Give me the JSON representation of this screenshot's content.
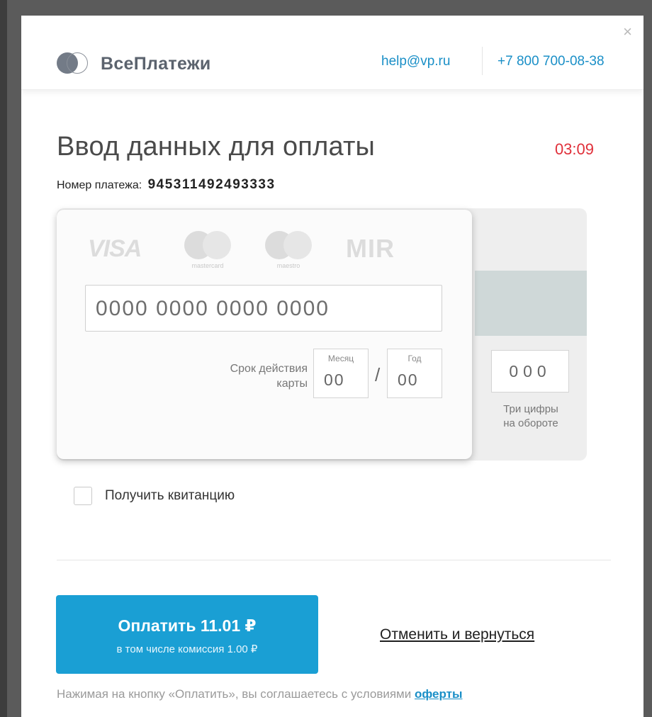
{
  "header": {
    "logo_text": "ВсеПлатежи",
    "email": "help@vp.ru",
    "phone": "+7 800 700-08-38",
    "close": "×"
  },
  "form": {
    "title": "Ввод данных для оплаты",
    "timer": "03:09",
    "payment_number_label": "Номер платежа:",
    "payment_number": "945311492493333"
  },
  "card": {
    "brands": {
      "visa": "VISA",
      "mastercard": "mastercard",
      "maestro": "maestro",
      "mir": "MIR"
    },
    "number_placeholder": "0000 0000 0000 0000",
    "expiry_label_line1": "Срок действия",
    "expiry_label_line2": "карты",
    "month_label": "Месяц",
    "month_placeholder": "00",
    "year_label": "Год",
    "year_placeholder": "00",
    "separator": "/",
    "cvv_placeholder": "000",
    "cvv_hint_line1": "Три цифры",
    "cvv_hint_line2": "на обороте"
  },
  "receipt": {
    "label": "Получить квитанцию",
    "checked": false
  },
  "actions": {
    "pay_label": "Оплатить 11.01 ₽",
    "pay_sub": "в том числе комиссия 1.00 ₽",
    "cancel_label": "Отменить и вернуться"
  },
  "terms": {
    "text": "Нажимая на кнопку «Оплатить», вы соглашаетесь с условиями",
    "link": "оферты"
  },
  "colors": {
    "accent": "#1a9fd4",
    "link": "#1a8fc7",
    "timer": "#e0303a",
    "overlay": "#5b5b5b"
  }
}
